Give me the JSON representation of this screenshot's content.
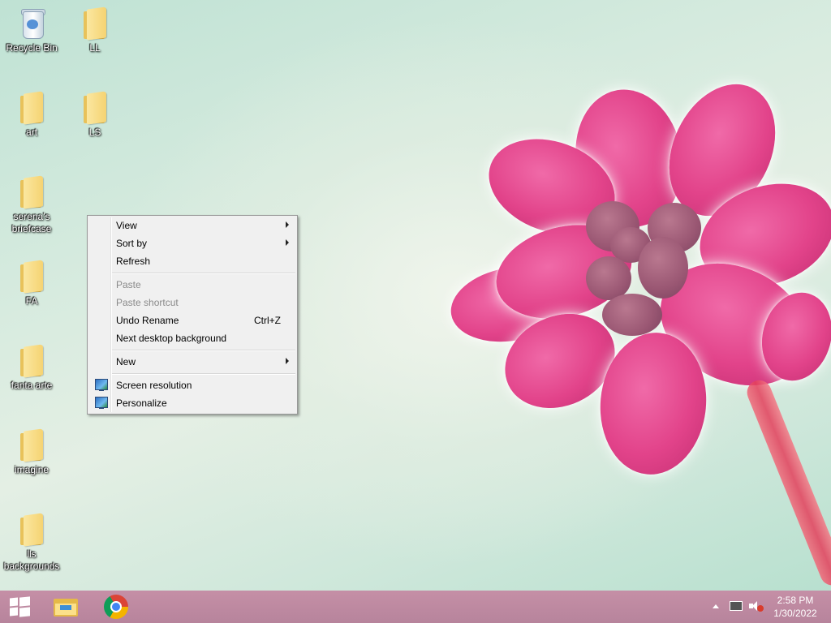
{
  "desktop": {
    "icons": [
      {
        "label": "Recycle Bin",
        "type": "recycle-bin"
      },
      {
        "label": "LL",
        "type": "folder"
      },
      {
        "label": "art",
        "type": "folder"
      },
      {
        "label": "LS",
        "type": "folder"
      },
      {
        "label": "serena's\nbriefcase",
        "type": "folder"
      },
      {
        "label": "FA",
        "type": "folder"
      },
      {
        "label": "fanta arte",
        "type": "folder"
      },
      {
        "label": "imagine",
        "type": "folder"
      },
      {
        "label": "lls\nbackgrounds",
        "type": "folder"
      }
    ]
  },
  "context_menu": {
    "items": [
      {
        "label": "View",
        "submenu": true
      },
      {
        "label": "Sort by",
        "submenu": true
      },
      {
        "label": "Refresh"
      },
      {
        "label": "Paste",
        "disabled": true
      },
      {
        "label": "Paste shortcut",
        "disabled": true
      },
      {
        "label": "Undo Rename",
        "shortcut": "Ctrl+Z"
      },
      {
        "label": "Next desktop background"
      },
      {
        "label": "New",
        "submenu": true
      },
      {
        "label": "Screen resolution",
        "icon": "display-icon"
      },
      {
        "label": "Personalize",
        "icon": "personalize-icon"
      }
    ]
  },
  "taskbar": {
    "pinned": [
      "file-explorer-icon",
      "chrome-icon"
    ],
    "tray_icons": [
      "show-hidden-icons-chevron",
      "network-icon",
      "volume-muted-icon"
    ],
    "clock": {
      "time": "2:58 PM",
      "date": "1/30/2022"
    }
  },
  "colors": {
    "taskbar": "#b7849c",
    "menu_bg": "#f0f0f0",
    "petal": "#e2438a"
  }
}
